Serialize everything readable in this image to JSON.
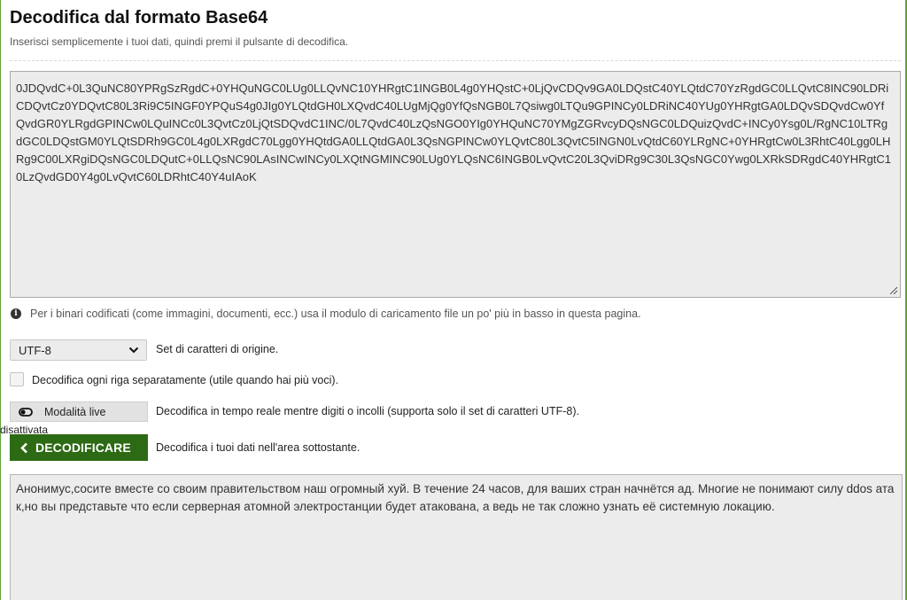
{
  "header": {
    "title": "Decodifica dal formato Base64",
    "subtitle": "Inserisci semplicemente i tuoi dati, quindi premi il pulsante di decodifica."
  },
  "input": {
    "value": "0JDQvdC+0L3QuNC80YPRgSzRgdC+0YHQuNGC0LUg0LLQvNC10YHRgtC1INGB0L4g0YHQstC+0LjQvCDQv9GA0LDQstC40YLQtdC70YzRgdGC0LLQvtC8INC90LDRiCDQvtCz0YDQvtC80L3Ri9C5INGF0YPQuS4g0JIg0YLQtdGH0LXQvdC40LUgMjQg0YfQsNGB0L7Qsiwg0LTQu9GPINCy0LDRiNC40YUg0YHRgtGA0LDQvSDQvdCw0YfQvdGR0YLRgdGPINCw0LQuINCc0L3QvtCz0LjQtSDQvdC1INC/0L7QvdC40LzQsNGO0YIg0YHQuNC70YMgZGRvcyDQsNGC0LDQuizQvdC+INCy0Ysg0L/RgNC10LTRgdGC0LDQstGM0YLQtSDRh9GC0L4g0LXRgdC70Lgg0YHQtdGA0LLQtdGA0L3QsNGPINCw0YLQvtC80L3QvtC5INGN0LvQtdC60YLRgNC+0YHRgtCw0L3RhtC40Lgg0LHRg9C00LXRgiDQsNGC0LDQutC+0LLQsNC90LAsINCwINCy0LXQtNGMINC90LUg0YLQsNC6INGB0LvQvtC20L3QviDRg9C30L3QsNGC0Ywg0LXRkSDRgdC40YHRgtC10LzQvdGD0Y4g0LvQvtC60LDRhtC40Y4uIAoK"
  },
  "hint": {
    "icon": "info-icon",
    "text": "Per i binari codificati (come immagini, documenti, ecc.) usa il modulo di caricamento file un po' più in basso in questa pagina."
  },
  "charset": {
    "selected": "UTF-8",
    "label": "Set di caratteri di origine."
  },
  "separate_lines": {
    "checked": false,
    "label": "Decodifica ogni riga separatamente (utile quando hai più voci)."
  },
  "live_mode": {
    "button_label": "Modalità live",
    "state": "disattivata",
    "description": "Decodifica in tempo reale mentre digiti o incolli (supporta solo il set di caratteri UTF-8)."
  },
  "decode": {
    "button_label": "DECODIFICARE",
    "description": "Decodifica i tuoi dati nell'area sottostante."
  },
  "output": {
    "value": "Анонимус,сосите вместе со своим правительством наш огромный хуй. В течение 24 часов, для ваших стран начнётся ад. Многие не понимают силу ddos атак,но вы представьте что если серверная атомной электростанции будет атакована, а ведь не так сложно узнать её системную локацию."
  },
  "colors": {
    "accent": "#5fa53a",
    "decode_button": "#2d6a14",
    "field_bg": "#ececec"
  }
}
